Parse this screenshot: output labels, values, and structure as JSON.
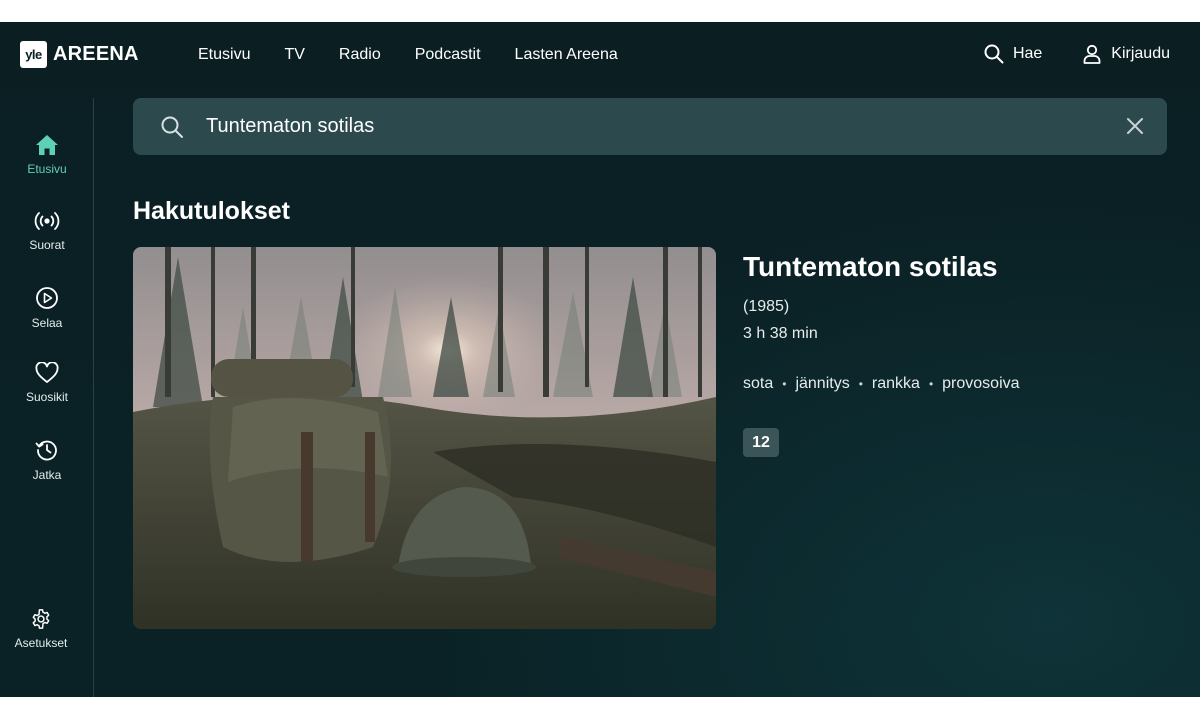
{
  "header": {
    "logo_yle": "yle",
    "logo_areena": "AREENA",
    "nav": [
      "Etusivu",
      "TV",
      "Radio",
      "Podcastit",
      "Lasten Areena"
    ],
    "search_label": "Hae",
    "login_label": "Kirjaudu"
  },
  "sidebar": {
    "items": [
      {
        "label": "Etusivu",
        "icon": "home-icon",
        "active": true
      },
      {
        "label": "Suorat",
        "icon": "live-broadcast-icon"
      },
      {
        "label": "Selaa",
        "icon": "play-circle-icon"
      },
      {
        "label": "Suosikit",
        "icon": "heart-icon"
      },
      {
        "label": "Jatka",
        "icon": "history-icon"
      }
    ],
    "settings_label": "Asetukset"
  },
  "search": {
    "value": "Tuntematon sotilas"
  },
  "results": {
    "heading": "Hakutulokset",
    "item": {
      "title": "Tuntematon sotilas",
      "year": "(1985)",
      "duration": "3 h 38 min",
      "tags": [
        "sota",
        "jännitys",
        "rankka",
        "provosoiva"
      ],
      "age_rating": "12"
    }
  },
  "colors": {
    "accent": "#5fd0b8",
    "background": "#0b1f23",
    "search_bg": "#2c4a4e"
  }
}
